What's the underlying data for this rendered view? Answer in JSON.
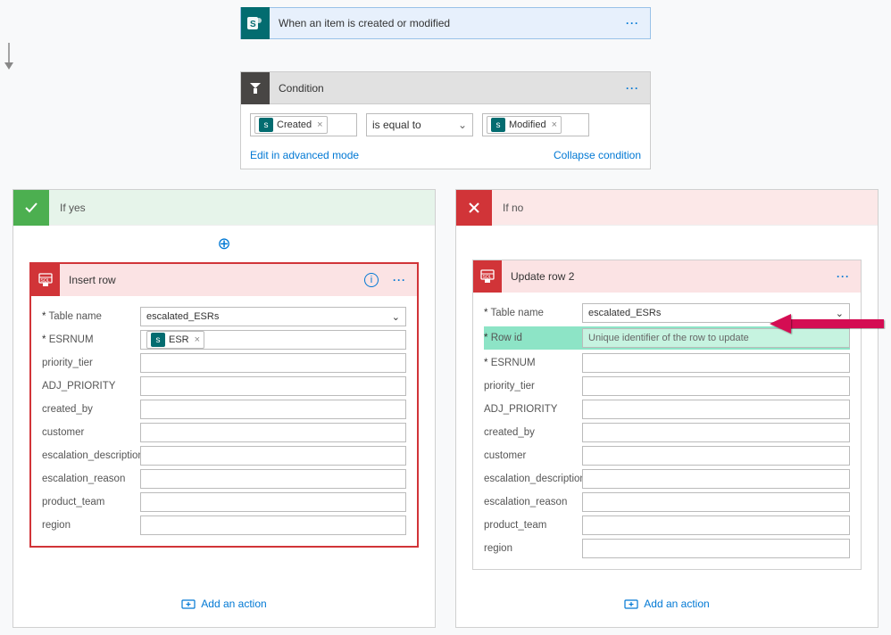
{
  "trigger": {
    "title": "When an item is created or modified"
  },
  "condition": {
    "title": "Condition",
    "left_token": "Created",
    "operator": "is equal to",
    "right_token": "Modified",
    "edit_link": "Edit in advanced mode",
    "collapse_link": "Collapse condition"
  },
  "branches": {
    "yes_label": "If yes",
    "no_label": "If no"
  },
  "insert_action": {
    "title": "Insert row",
    "fields": {
      "table_name": {
        "label": "Table name",
        "value": "escalated_ESRs",
        "required": true,
        "dropdown": true
      },
      "esrnum": {
        "label": "ESRNUM",
        "token": "ESR",
        "required": true
      },
      "priority_tier": {
        "label": "priority_tier"
      },
      "adj_priority": {
        "label": "ADJ_PRIORITY"
      },
      "created_by": {
        "label": "created_by"
      },
      "customer": {
        "label": "customer"
      },
      "escalation_description": {
        "label": "escalation_description"
      },
      "escalation_reason": {
        "label": "escalation_reason"
      },
      "product_team": {
        "label": "product_team"
      },
      "region": {
        "label": "region"
      }
    }
  },
  "update_action": {
    "title": "Update row 2",
    "fields": {
      "table_name": {
        "label": "Table name",
        "value": "escalated_ESRs",
        "required": true,
        "dropdown": true
      },
      "row_id": {
        "label": "Row id",
        "placeholder": "Unique identifier of the row to update",
        "required": true,
        "highlight": true
      },
      "esrnum": {
        "label": "ESRNUM",
        "required": true
      },
      "priority_tier": {
        "label": "priority_tier"
      },
      "adj_priority": {
        "label": "ADJ_PRIORITY"
      },
      "created_by": {
        "label": "created_by"
      },
      "customer": {
        "label": "customer"
      },
      "escalation_description": {
        "label": "escalation_description"
      },
      "escalation_reason": {
        "label": "escalation_reason"
      },
      "product_team": {
        "label": "product_team"
      },
      "region": {
        "label": "region"
      }
    }
  },
  "add_action_label": "Add an action"
}
